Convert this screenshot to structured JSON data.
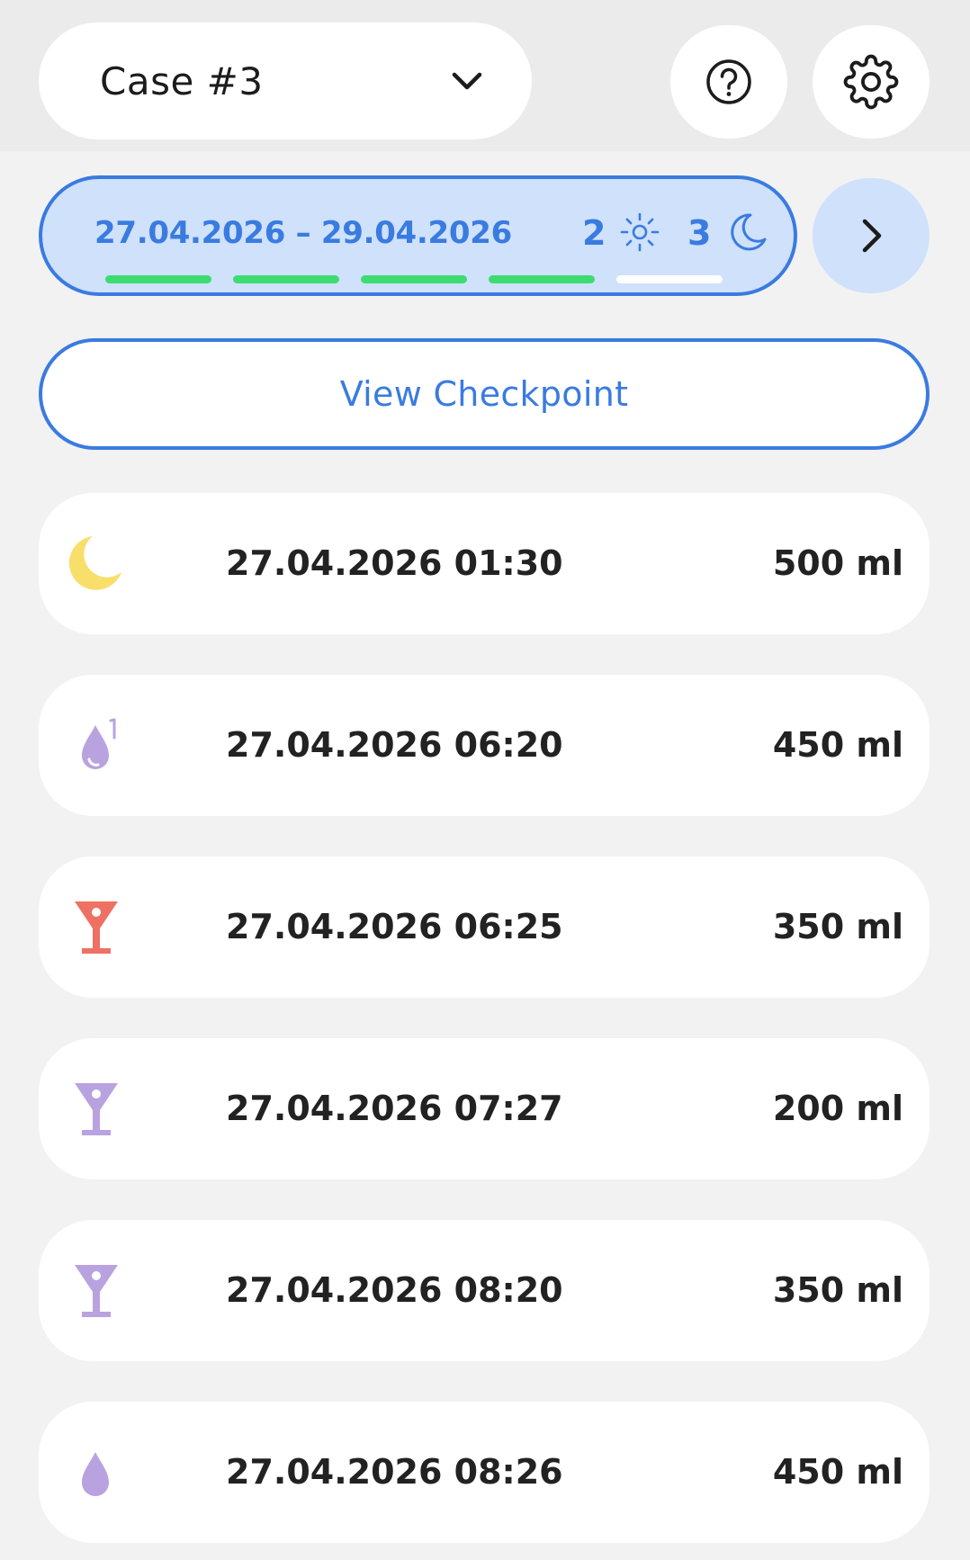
{
  "header": {
    "case_label": "Case #3",
    "case_dropdown_icon": "chevron-down-icon",
    "help_icon": "help-circle-icon",
    "settings_icon": "gear-icon"
  },
  "period": {
    "range": "27.04.2026 – 29.04.2026",
    "days": "2",
    "nights": "3",
    "day_icon": "sun-icon",
    "night_icon": "moon-outline-icon",
    "progress": [
      {
        "state": "complete"
      },
      {
        "state": "complete"
      },
      {
        "state": "complete"
      },
      {
        "state": "complete"
      },
      {
        "state": "pending"
      }
    ],
    "next_icon": "chevron-right-icon"
  },
  "checkpoint_button": {
    "label": "View Checkpoint"
  },
  "entries": [
    {
      "icon": "moon-icon",
      "datetime": "27.04.2026 01:30",
      "volume": "500 ml"
    },
    {
      "icon": "drop-with-marker-icon",
      "datetime": "27.04.2026 06:20",
      "volume": "450 ml"
    },
    {
      "icon": "cocktail-glass-red-icon",
      "datetime": "27.04.2026 06:25",
      "volume": "350 ml"
    },
    {
      "icon": "cocktail-glass-purple-icon",
      "datetime": "27.04.2026 07:27",
      "volume": "200 ml"
    },
    {
      "icon": "cocktail-glass-purple-icon",
      "datetime": "27.04.2026 08:20",
      "volume": "350 ml"
    },
    {
      "icon": "drop-icon",
      "datetime": "27.04.2026 08:26",
      "volume": "450 ml"
    }
  ],
  "colors": {
    "accent": "#3a7be0",
    "accent_light": "#cfe1fb",
    "progress_complete": "#3ddc73",
    "progress_pending": "#ffffff",
    "moon_yellow": "#f8df6c",
    "drop_purple": "#b9a2e0",
    "glass_red": "#ee7164",
    "glass_purple": "#b9a2e0",
    "background": "#f2f2f2"
  }
}
